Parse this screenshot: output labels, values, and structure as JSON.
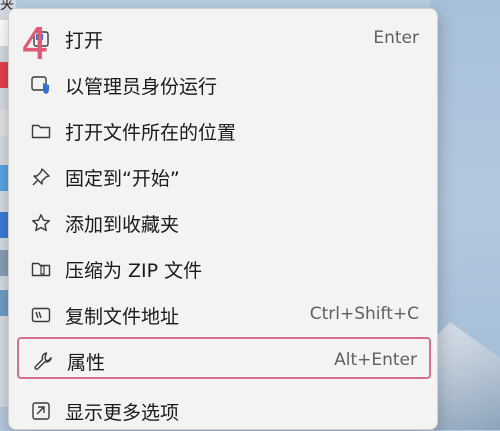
{
  "desktop": {
    "top_label": "夹"
  },
  "annotation": {
    "step_number": "4",
    "color": "#e05a78"
  },
  "menu": {
    "items": [
      {
        "label": "打开",
        "shortcut": "Enter",
        "icon": "open-app-icon"
      },
      {
        "label": "以管理员身份运行",
        "shortcut": "",
        "icon": "admin-shield-icon"
      },
      {
        "label": "打开文件所在的位置",
        "shortcut": "",
        "icon": "folder-icon"
      },
      {
        "label": "固定到“开始”",
        "shortcut": "",
        "icon": "pin-icon"
      },
      {
        "label": "添加到收藏夹",
        "shortcut": "",
        "icon": "star-icon"
      },
      {
        "label": "压缩为 ZIP 文件",
        "shortcut": "",
        "icon": "zip-folder-icon"
      },
      {
        "label": "复制文件地址",
        "shortcut": "Ctrl+Shift+C",
        "icon": "copy-path-icon"
      },
      {
        "label": "属性",
        "shortcut": "Alt+Enter",
        "icon": "wrench-icon"
      },
      {
        "label": "显示更多选项",
        "shortcut": "",
        "icon": "more-options-icon"
      }
    ],
    "highlighted_item": "属性",
    "highlight_color": "#d9708a"
  }
}
